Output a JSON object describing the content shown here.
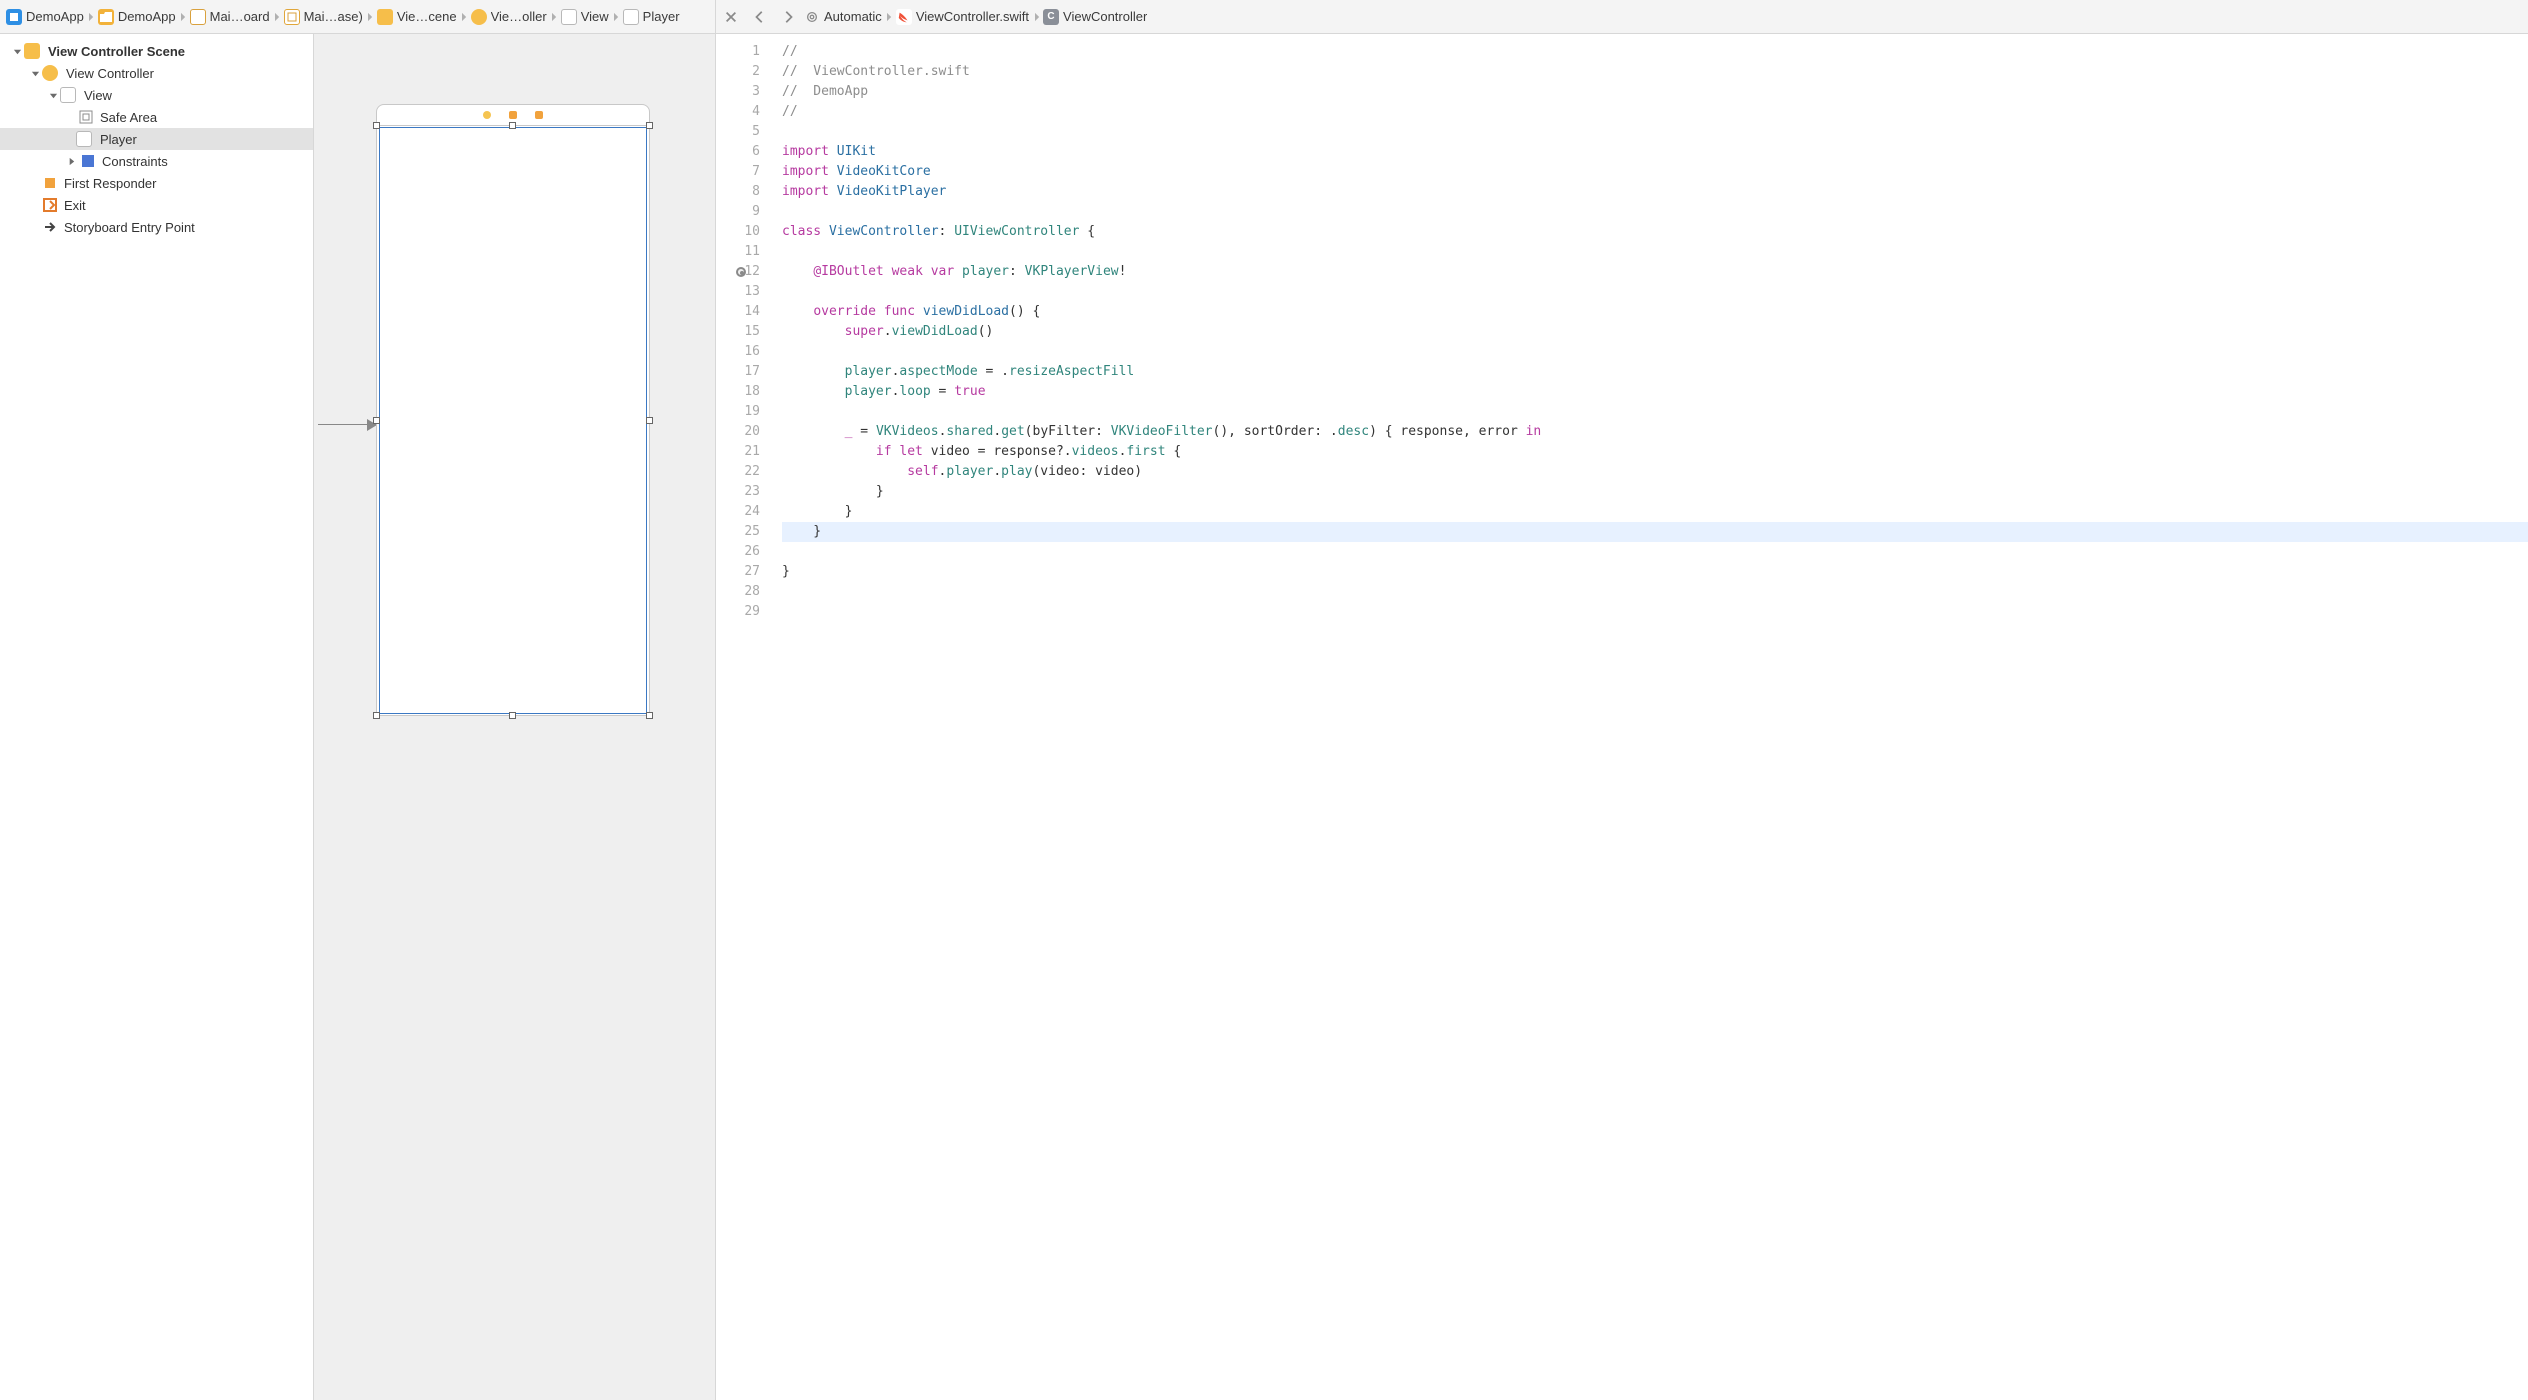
{
  "jumpbar_left": [
    {
      "icon": "proj",
      "label": "DemoApp"
    },
    {
      "icon": "folder",
      "label": "DemoApp"
    },
    {
      "icon": "story",
      "label": "Mai…oard"
    },
    {
      "icon": "sb",
      "label": "Mai…ase)"
    },
    {
      "icon": "scene",
      "label": "Vie…cene"
    },
    {
      "icon": "vc",
      "label": "Vie…oller"
    },
    {
      "icon": "view",
      "label": "View"
    },
    {
      "icon": "view",
      "label": "Player"
    }
  ],
  "jumpbar_right": [
    {
      "icon": "auto",
      "label": "Automatic"
    },
    {
      "icon": "swift",
      "label": "ViewController.swift"
    },
    {
      "icon": "class",
      "label": "ViewController"
    }
  ],
  "outline": {
    "scene": "View Controller Scene",
    "vc": "View Controller",
    "view": "View",
    "safe": "Safe Area",
    "player": "Player",
    "constraints": "Constraints",
    "fr": "First Responder",
    "exit": "Exit",
    "sep": "Storyboard Entry Point"
  },
  "code_lines": [
    {
      "n": 1,
      "html": "<span class='c-com'>//</span>"
    },
    {
      "n": 2,
      "html": "<span class='c-com'>//  ViewController.swift</span>"
    },
    {
      "n": 3,
      "html": "<span class='c-com'>//  DemoApp</span>"
    },
    {
      "n": 4,
      "html": "<span class='c-com'>//</span>"
    },
    {
      "n": 5,
      "html": ""
    },
    {
      "n": 6,
      "html": "<span class='c-kw'>import</span> <span class='c-type'>UIKit</span>"
    },
    {
      "n": 7,
      "html": "<span class='c-kw'>import</span> <span class='c-type'>VideoKitCore</span>"
    },
    {
      "n": 8,
      "html": "<span class='c-kw'>import</span> <span class='c-type'>VideoKitPlayer</span>"
    },
    {
      "n": 9,
      "html": ""
    },
    {
      "n": 10,
      "html": "<span class='c-kw'>class</span> <span class='c-type'>ViewController</span>: <span class='c-type2'>UIViewController</span> {"
    },
    {
      "n": 11,
      "html": ""
    },
    {
      "n": 12,
      "outlet": true,
      "html": "    <span class='c-kw'>@IBOutlet</span> <span class='c-kw'>weak</span> <span class='c-kw'>var</span> <span class='c-prop'>player</span>: <span class='c-type2'>VKPlayerView</span>!"
    },
    {
      "n": 13,
      "html": ""
    },
    {
      "n": 14,
      "html": "    <span class='c-kw'>override</span> <span class='c-kw'>func</span> <span class='c-func'>viewDidLoad</span>() {"
    },
    {
      "n": 15,
      "html": "        <span class='c-kw'>super</span>.<span class='c-prop'>viewDidLoad</span>()"
    },
    {
      "n": 16,
      "html": ""
    },
    {
      "n": 17,
      "html": "        <span class='c-prop'>player</span>.<span class='c-prop'>aspectMode</span> = .<span class='c-prop'>resizeAspectFill</span>"
    },
    {
      "n": 18,
      "html": "        <span class='c-prop'>player</span>.<span class='c-prop'>loop</span> = <span class='c-kw'>true</span>"
    },
    {
      "n": 19,
      "html": ""
    },
    {
      "n": 20,
      "html": "        <span class='c-kw'>_</span> = <span class='c-type2'>VKVideos</span>.<span class='c-prop'>shared</span>.<span class='c-prop'>get</span>(byFilter: <span class='c-type2'>VKVideoFilter</span>(), sortOrder: .<span class='c-prop'>desc</span>) { response, error <span class='c-kw'>in</span>"
    },
    {
      "n": 21,
      "html": "            <span class='c-kw'>if</span> <span class='c-kw'>let</span> video = response?.<span class='c-prop'>videos</span>.<span class='c-prop'>first</span> {"
    },
    {
      "n": 22,
      "html": "                <span class='c-kw'>self</span>.<span class='c-prop'>player</span>.<span class='c-prop'>play</span>(video: video)"
    },
    {
      "n": 23,
      "html": "            }"
    },
    {
      "n": 24,
      "html": "        }"
    },
    {
      "n": 25,
      "current": true,
      "html": "    }"
    },
    {
      "n": 26,
      "html": ""
    },
    {
      "n": 27,
      "html": "}"
    },
    {
      "n": 28,
      "html": ""
    },
    {
      "n": 29,
      "html": ""
    }
  ]
}
